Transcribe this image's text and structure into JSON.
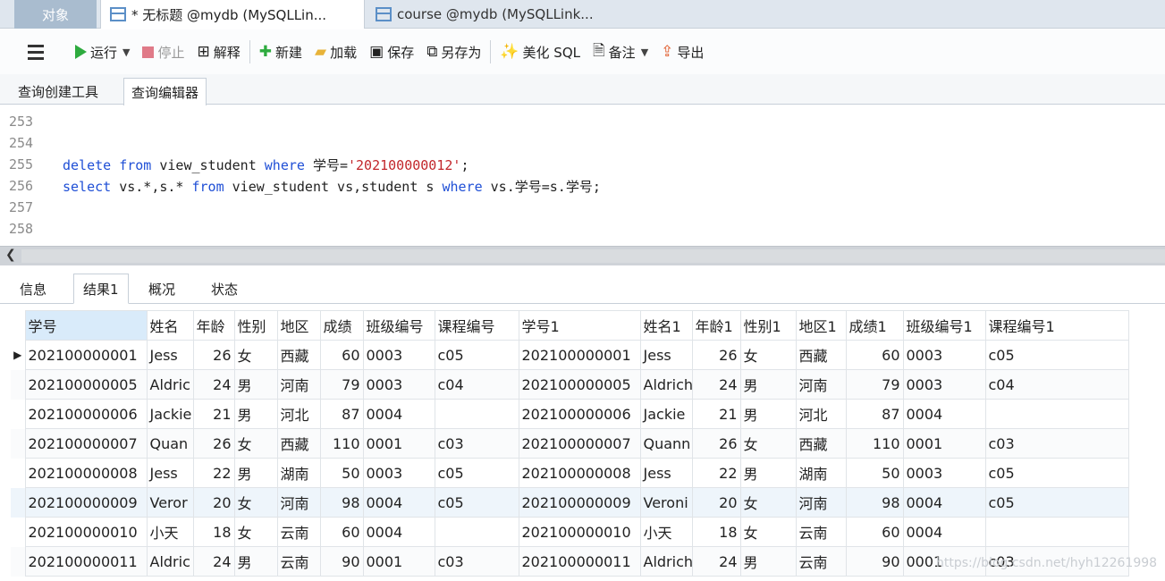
{
  "tabs": {
    "objects": "对象",
    "tab1": "* 无标题 @mydb (MySQLLin...",
    "tab2": "course @mydb (MySQLLink..."
  },
  "toolbar": {
    "run": "运行",
    "stop": "停止",
    "explain": "解释",
    "new": "新建",
    "load": "加载",
    "save": "保存",
    "save_as": "另存为",
    "beautify": "美化 SQL",
    "comment": "备注",
    "export": "导出"
  },
  "subtabs": {
    "builder": "查询创建工具",
    "editor": "查询编辑器"
  },
  "editor": {
    "line_numbers": [
      "253",
      "254",
      "255",
      "256",
      "257",
      "258"
    ],
    "line255": {
      "kw1": "delete",
      "kw2": "from",
      "t1": " view_student ",
      "kw3": "where",
      "t2": " 学号=",
      "s1": "'202100000012'",
      "t3": ";"
    },
    "line256": {
      "kw1": "select",
      "t1": " vs.*,s.* ",
      "kw2": "from",
      "t2": " view_student vs,student s ",
      "kw3": "where",
      "t3": " vs.学号=s.学号;"
    }
  },
  "result_tabs": [
    "信息",
    "结果1",
    "概况",
    "状态"
  ],
  "grid": {
    "headers": [
      "学号",
      "姓名",
      "年龄",
      "性别",
      "地区",
      "成绩",
      "班级编号",
      "课程编号",
      "学号1",
      "姓名1",
      "年龄1",
      "性别1",
      "地区1",
      "成绩1",
      "班级编号1",
      "课程编号1"
    ],
    "rows": [
      [
        "202100000001",
        "Jess",
        "26",
        "女",
        "西藏",
        "60",
        "0003",
        "c05",
        "202100000001",
        "Jess",
        "26",
        "女",
        "西藏",
        "60",
        "0003",
        "c05"
      ],
      [
        "202100000005",
        "Aldric",
        "24",
        "男",
        "河南",
        "79",
        "0003",
        "c04",
        "202100000005",
        "Aldrich",
        "24",
        "男",
        "河南",
        "79",
        "0003",
        "c04"
      ],
      [
        "202100000006",
        "Jackie",
        "21",
        "男",
        "河北",
        "87",
        "0004",
        "",
        "202100000006",
        "Jackie",
        "21",
        "男",
        "河北",
        "87",
        "0004",
        ""
      ],
      [
        "202100000007",
        "Quan",
        "26",
        "女",
        "西藏",
        "110",
        "0001",
        "c03",
        "202100000007",
        "Quann",
        "26",
        "女",
        "西藏",
        "110",
        "0001",
        "c03"
      ],
      [
        "202100000008",
        "Jess",
        "22",
        "男",
        "湖南",
        "50",
        "0003",
        "c05",
        "202100000008",
        "Jess",
        "22",
        "男",
        "湖南",
        "50",
        "0003",
        "c05"
      ],
      [
        "202100000009",
        "Veror",
        "20",
        "女",
        "河南",
        "98",
        "0004",
        "c05",
        "202100000009",
        "Veroni",
        "20",
        "女",
        "河南",
        "98",
        "0004",
        "c05"
      ],
      [
        "202100000010",
        "小天",
        "18",
        "女",
        "云南",
        "60",
        "0004",
        "",
        "202100000010",
        "小天",
        "18",
        "女",
        "云南",
        "60",
        "0004",
        ""
      ],
      [
        "202100000011",
        "Aldric",
        "24",
        "男",
        "云南",
        "90",
        "0001",
        "c03",
        "202100000011",
        "Aldrich",
        "24",
        "男",
        "云南",
        "90",
        "0001",
        "c03"
      ]
    ]
  },
  "watermark": "https://blog.csdn.net/hyh12261998"
}
